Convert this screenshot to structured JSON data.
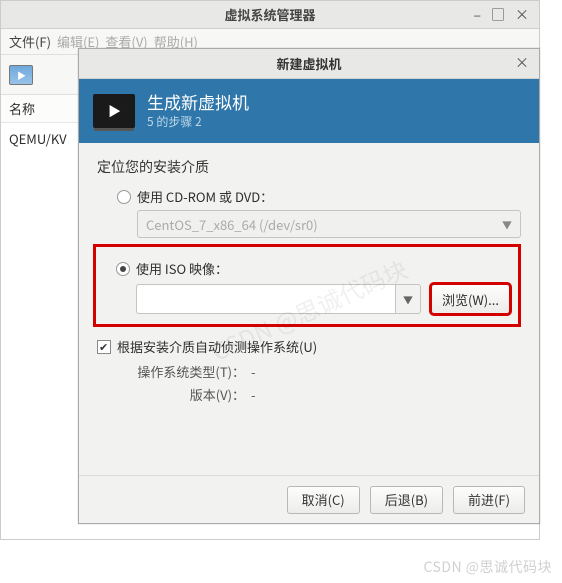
{
  "parent": {
    "title": "虚拟系统管理器",
    "menu": {
      "file": "文件(F)",
      "edit": "编辑(E)",
      "view": "查看(V)",
      "help": "帮助(H)"
    },
    "list_header": "名称",
    "list_row": "QEMU/KV"
  },
  "dialog": {
    "title": "新建虚拟机",
    "header_title": "生成新虚拟机",
    "header_step": "5 的步骤 2",
    "section_label": "定位您的安装介质",
    "radio_cdrom": "使用 CD-ROM 或 DVD：",
    "cdrom_value": "CentOS_7_x86_64 (/dev/sr0)",
    "radio_iso": "使用 ISO 映像：",
    "iso_value": "",
    "browse": "浏览(W)...",
    "autodetect": "根据安装介质自动侦测操作系统(U)",
    "os_type_label": "操作系统类型(T)：",
    "os_type_value": "-",
    "version_label": "版本(V)：",
    "version_value": "-",
    "cancel": "取消(C)",
    "back": "后退(B)",
    "forward": "前进(F)"
  },
  "watermark": "CSDN @思诚代码块"
}
